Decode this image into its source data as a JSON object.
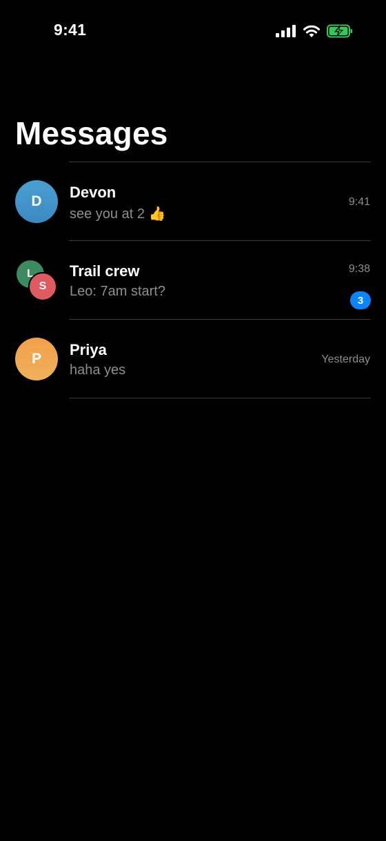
{
  "status_bar": {
    "time": "9:41",
    "icons": [
      "cellular-signal-icon",
      "wifi-icon",
      "battery-charging-icon"
    ],
    "battery_color": "#34c759"
  },
  "header": {
    "title": "Messages"
  },
  "conversations": [
    {
      "name": "Devon",
      "preview": "see you at 2 👍",
      "time": "9:41",
      "avatar_initial": "D",
      "avatar_color": "#4a9fd1"
    },
    {
      "name": "Trail crew",
      "preview": "Leo: 7am start?",
      "time": "9:38",
      "unread_count": "3",
      "group_avatar_initials": [
        "L",
        "S"
      ],
      "avatar_colors": [
        "#3c8a5d",
        "#e05a62"
      ]
    },
    {
      "name": "Priya",
      "preview": "haha yes",
      "time": "Yesterday",
      "avatar_initial": "P",
      "avatar_color": "#f3a04a"
    }
  ],
  "colors": {
    "background": "#000000",
    "secondary_text": "#8e8e93",
    "separator": "#3a3a3c",
    "unread_badge": "#0a84ff"
  }
}
